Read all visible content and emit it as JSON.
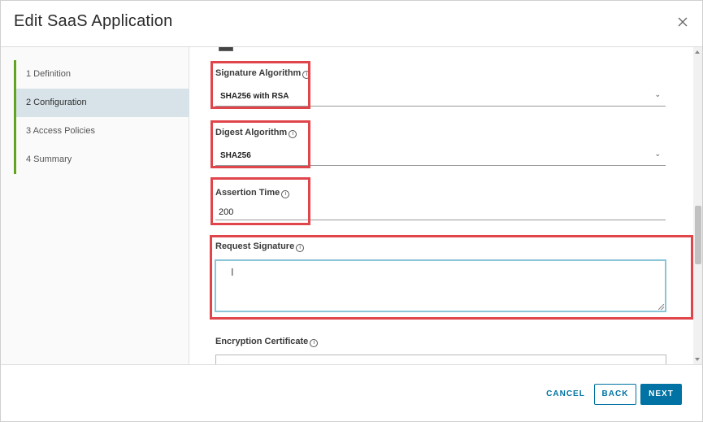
{
  "header": {
    "title": "Edit SaaS Application",
    "close_icon": "close-icon"
  },
  "sidebar": {
    "steps": [
      {
        "label": "1 Definition"
      },
      {
        "label": "2 Configuration",
        "active": true
      },
      {
        "label": "3 Access Policies"
      },
      {
        "label": "4 Summary"
      }
    ],
    "accent_color": "#62a420",
    "active_bg": "#d8e3e9"
  },
  "form": {
    "signature_algorithm": {
      "label": "Signature Algorithm",
      "value": "SHA256 with RSA"
    },
    "digest_algorithm": {
      "label": "Digest Algorithm",
      "value": "SHA256"
    },
    "assertion_time": {
      "label": "Assertion Time",
      "value": "200"
    },
    "request_signature": {
      "label": "Request Signature",
      "value": ""
    },
    "encryption_certificate": {
      "label": "Encryption Certificate",
      "value": ""
    },
    "info_icon_glyph": "i",
    "highlight_color": "#e0454b"
  },
  "footer": {
    "cancel_label": "CANCEL",
    "back_label": "BACK",
    "next_label": "NEXT",
    "primary_color": "#0072a3"
  }
}
